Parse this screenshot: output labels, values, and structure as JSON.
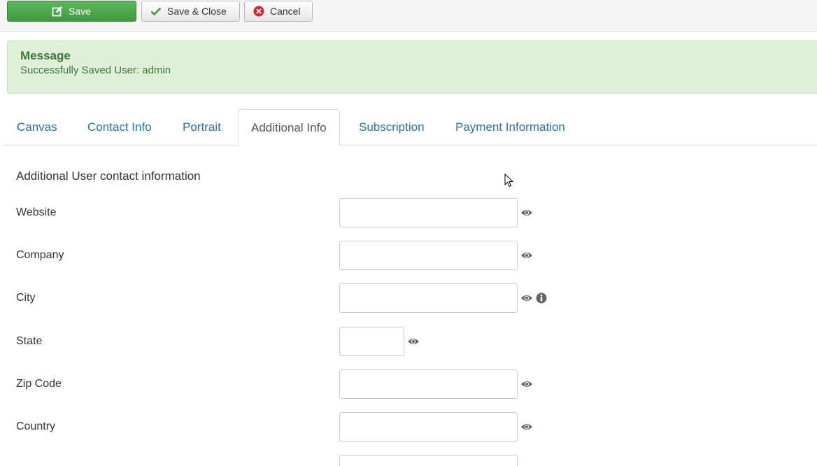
{
  "toolbar": {
    "save_label": "Save",
    "save_close_label": "Save & Close",
    "cancel_label": "Cancel",
    "icons": {
      "save": "edit-icon",
      "save_close": "checkmark-icon",
      "cancel": "cancel-circle-icon"
    }
  },
  "message": {
    "title": "Message",
    "text": "Successfully Saved User: admin"
  },
  "tabs": [
    {
      "label": "Canvas",
      "active": false
    },
    {
      "label": "Contact Info",
      "active": false
    },
    {
      "label": "Portrait",
      "active": false
    },
    {
      "label": "Additional Info",
      "active": true
    },
    {
      "label": "Subscription",
      "active": false
    },
    {
      "label": "Payment Information",
      "active": false
    }
  ],
  "form": {
    "section_title": "Additional User contact information",
    "fields": [
      {
        "label": "Website",
        "value": "",
        "icons": [
          "eye-icon"
        ]
      },
      {
        "label": "Company",
        "value": "",
        "icons": [
          "eye-icon"
        ]
      },
      {
        "label": "City",
        "value": "",
        "icons": [
          "eye-icon",
          "info-icon"
        ]
      },
      {
        "label": "State",
        "value": "",
        "icons": [
          "eye-icon"
        ]
      },
      {
        "label": "Zip Code",
        "value": "",
        "icons": [
          "eye-icon"
        ]
      },
      {
        "label": "Country",
        "value": "",
        "icons": [
          "eye-icon"
        ]
      }
    ]
  },
  "colors": {
    "accent_link": "#2a6fb5",
    "save_button": "#4cae4c",
    "success_bg": "#dff0d8",
    "success_text": "#3c763d",
    "cancel_icon": "#d9262c"
  }
}
